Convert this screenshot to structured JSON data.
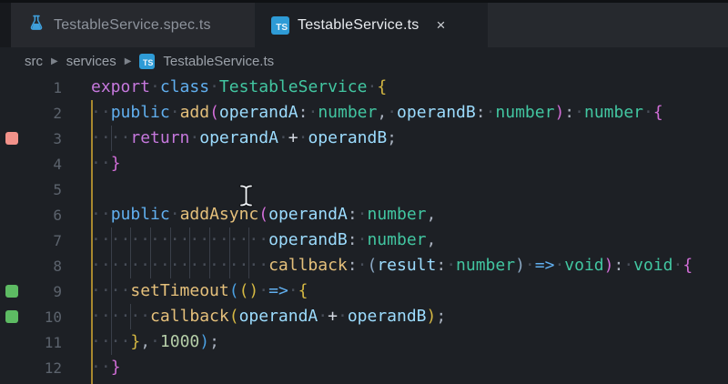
{
  "tabs": [
    {
      "label": "TestableService.spec.ts",
      "icon": "flask-icon",
      "state": "inactive"
    },
    {
      "label": "TestableService.ts",
      "icon": "typescript-icon",
      "state": "active",
      "close_label": "×"
    }
  ],
  "badges": {
    "ts_text": "TS"
  },
  "breadcrumb": {
    "separator": "▶",
    "segments": [
      "src",
      "services",
      "TestableService.ts"
    ]
  },
  "colors": {
    "editor_bg": "#1d2025",
    "tab_bar_bg": "#26292e",
    "accent_blue": "#2e9bd6",
    "marker_red": "#f2928a",
    "marker_green": "#5dbb63",
    "bracket_gold": "#d4b742",
    "bracket_orchid": "#d06dd6",
    "bracket_blue": "#4a9fe0",
    "scope_guide_gold": "#a8882e"
  },
  "editor": {
    "char_width": 10.84,
    "lines": [
      {
        "num": "1",
        "marker": null,
        "guides": [],
        "tokens": [
          [
            "export",
            "kp"
          ],
          [
            " ",
            "ws"
          ],
          [
            "class",
            "kb"
          ],
          [
            " ",
            "ws"
          ],
          [
            "TestableService",
            "ty"
          ],
          [
            " ",
            "ws"
          ],
          [
            "{",
            "b1"
          ]
        ]
      },
      {
        "num": "2",
        "marker": null,
        "guides": [],
        "tokens": [
          [
            "  ",
            "ws"
          ],
          [
            "public",
            "kb"
          ],
          [
            " ",
            "ws"
          ],
          [
            "add",
            "fn"
          ],
          [
            "(",
            "b2"
          ],
          [
            "operandA",
            "pm"
          ],
          [
            ":",
            "pu"
          ],
          [
            " ",
            "ws"
          ],
          [
            "number",
            "ty"
          ],
          [
            ",",
            "pu"
          ],
          [
            " ",
            "ws"
          ],
          [
            "operandB",
            "pm"
          ],
          [
            ":",
            "pu"
          ],
          [
            " ",
            "ws"
          ],
          [
            "number",
            "ty"
          ],
          [
            ")",
            "b2"
          ],
          [
            ":",
            "pu"
          ],
          [
            " ",
            "ws"
          ],
          [
            "number",
            "ty"
          ],
          [
            " ",
            "ws"
          ],
          [
            "{",
            "b2"
          ]
        ]
      },
      {
        "num": "3",
        "marker": "red",
        "guides": [
          2
        ],
        "tokens": [
          [
            "    ",
            "ws"
          ],
          [
            "return",
            "kp"
          ],
          [
            " ",
            "ws"
          ],
          [
            "operandA",
            "pm"
          ],
          [
            " ",
            "ws"
          ],
          [
            "+",
            "op"
          ],
          [
            " ",
            "ws"
          ],
          [
            "operandB",
            "pm"
          ],
          [
            ";",
            "pu"
          ]
        ]
      },
      {
        "num": "4",
        "marker": null,
        "guides": [],
        "tokens": [
          [
            "  ",
            "ws"
          ],
          [
            "}",
            "b2"
          ]
        ]
      },
      {
        "num": "5",
        "marker": null,
        "guides": [],
        "tokens": []
      },
      {
        "num": "6",
        "marker": null,
        "guides": [],
        "tokens": [
          [
            "  ",
            "ws"
          ],
          [
            "public",
            "kb"
          ],
          [
            " ",
            "ws"
          ],
          [
            "addAsync",
            "fn"
          ],
          [
            "(",
            "b2"
          ],
          [
            "operandA",
            "pm"
          ],
          [
            ":",
            "pu"
          ],
          [
            " ",
            "ws"
          ],
          [
            "number",
            "ty"
          ],
          [
            ",",
            "pu"
          ]
        ]
      },
      {
        "num": "7",
        "marker": null,
        "guides": [
          2,
          4,
          6,
          8,
          10,
          12,
          14,
          16
        ],
        "tokens": [
          [
            "                  ",
            "ws"
          ],
          [
            "operandB",
            "pm"
          ],
          [
            ":",
            "pu"
          ],
          [
            " ",
            "ws"
          ],
          [
            "number",
            "ty"
          ],
          [
            ",",
            "pu"
          ]
        ]
      },
      {
        "num": "8",
        "marker": null,
        "guides": [
          2,
          4,
          6,
          8,
          10,
          12,
          14,
          16
        ],
        "tokens": [
          [
            "                  ",
            "ws"
          ],
          [
            "callback",
            "fn"
          ],
          [
            ":",
            "pu"
          ],
          [
            " ",
            "ws"
          ],
          [
            "(",
            "pb"
          ],
          [
            "result",
            "pm"
          ],
          [
            ":",
            "pu"
          ],
          [
            " ",
            "ws"
          ],
          [
            "number",
            "ty"
          ],
          [
            ")",
            "pb"
          ],
          [
            " ",
            "ws"
          ],
          [
            "=>",
            "kb"
          ],
          [
            " ",
            "ws"
          ],
          [
            "void",
            "ty"
          ],
          [
            ")",
            "b2"
          ],
          [
            ":",
            "pu"
          ],
          [
            " ",
            "ws"
          ],
          [
            "void",
            "ty"
          ],
          [
            " ",
            "ws"
          ],
          [
            "{",
            "b2"
          ]
        ]
      },
      {
        "num": "9",
        "marker": "green",
        "guides": [
          2
        ],
        "tokens": [
          [
            "    ",
            "ws"
          ],
          [
            "setTimeout",
            "fn"
          ],
          [
            "(",
            "b3"
          ],
          [
            "(",
            "b1"
          ],
          [
            ")",
            "b1"
          ],
          [
            " ",
            "ws"
          ],
          [
            "=>",
            "kb"
          ],
          [
            " ",
            "ws"
          ],
          [
            "{",
            "b1"
          ]
        ]
      },
      {
        "num": "10",
        "marker": "green",
        "guides": [
          2,
          4
        ],
        "tokens": [
          [
            "      ",
            "ws"
          ],
          [
            "callback",
            "fn"
          ],
          [
            "(",
            "b1"
          ],
          [
            "operandA",
            "pm"
          ],
          [
            " ",
            "ws"
          ],
          [
            "+",
            "op"
          ],
          [
            " ",
            "ws"
          ],
          [
            "operandB",
            "pm"
          ],
          [
            ")",
            "b1"
          ],
          [
            ";",
            "pu"
          ]
        ]
      },
      {
        "num": "11",
        "marker": null,
        "guides": [
          2
        ],
        "tokens": [
          [
            "    ",
            "ws"
          ],
          [
            "}",
            "b1"
          ],
          [
            ",",
            "pu"
          ],
          [
            " ",
            "ws"
          ],
          [
            "1000",
            "nu"
          ],
          [
            ")",
            "b3"
          ],
          [
            ";",
            "pu"
          ]
        ]
      },
      {
        "num": "12",
        "marker": null,
        "guides": [],
        "tokens": [
          [
            "  ",
            "ws"
          ],
          [
            "}",
            "b2"
          ]
        ]
      }
    ]
  }
}
